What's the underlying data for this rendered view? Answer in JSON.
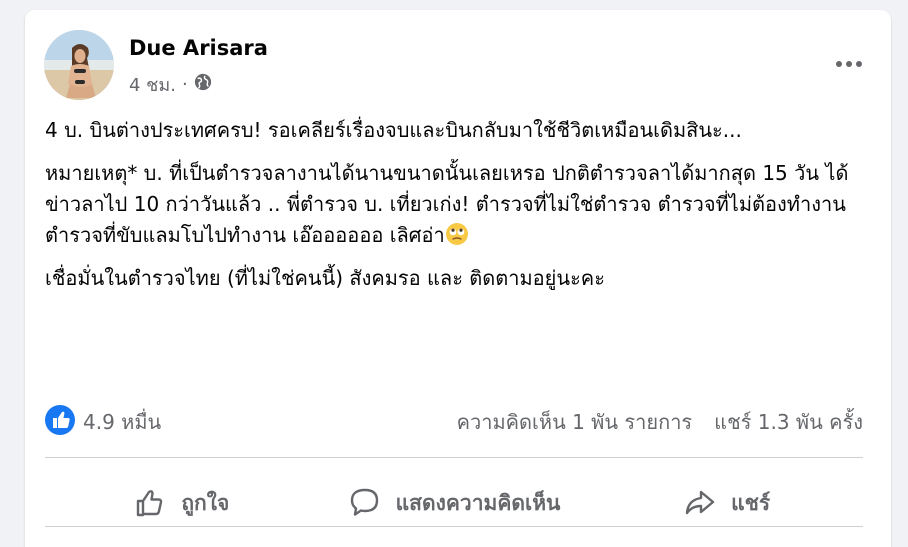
{
  "post": {
    "author": "Due Arisara",
    "time": "4 ชม.",
    "dot": "·",
    "paragraphs": [
      "4 บ. บินต่างประเทศครบ! รอเคลียร์เรื่องจบและบินกลับมาใช้ชีวิตเหมือนเดิมสินะ...",
      "หมายเหตุ* บ. ที่เป็นตำรวจลางานได้นานขนาดนั้นเลยเหรอ ปกติตำรวจลาได้มากสุด 15 วัน ได้ข่าวลาไป 10 กว่าวันแล้ว .. พี่ตำรวจ บ. เที่ยวเก่ง! ตำรวจที่ไม่ใช่ตำรวจ ตำรวจที่ไม่ต้องทำงาน ตำรวจที่ขับแลมโบไปทำงาน เอ๊ออออออ เลิศอ่า",
      "เชื่อมั่นในตำรวจไทย (ที่ไม่ใช่คนนี้) สังคมรอ และ ติดตามอยู่นะคะ"
    ],
    "emoji": "eye-roll-emoji"
  },
  "stats": {
    "likes": "4.9 หมื่น",
    "comments": "ความคิดเห็น 1 พัน รายการ",
    "shares": "แชร์ 1.3 พัน ครั้ง"
  },
  "actions": {
    "like": "ถูกใจ",
    "comment": "แสดงความคิดเห็น",
    "share": "แชร์"
  },
  "colors": {
    "background": "#f0f2f5",
    "card": "#ffffff",
    "secondary_text": "#65676b",
    "like_blue": "#1877f2"
  }
}
